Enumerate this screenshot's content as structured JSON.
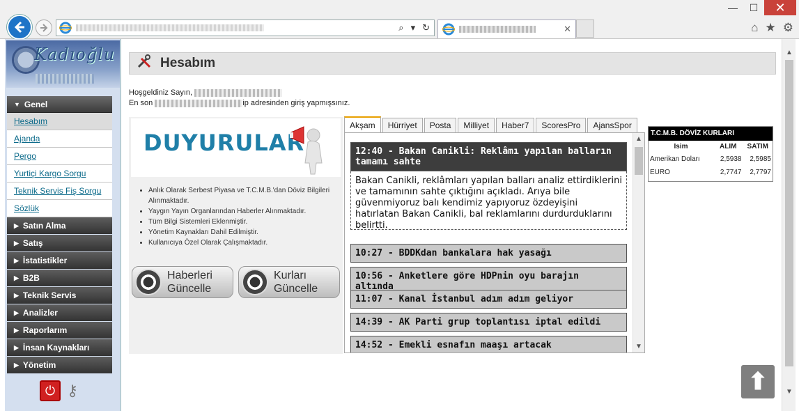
{
  "browser": {
    "back_icon": "back-arrow-icon",
    "forward_icon": "forward-arrow-icon",
    "minimize": "—",
    "maximize": "☐",
    "close": "✕",
    "addr_controls": [
      "⌕",
      "▾",
      "↻"
    ],
    "tab_close": "✕",
    "right_icons": [
      "⌂",
      "★",
      "⚙"
    ]
  },
  "sidebar": {
    "section_header": "Genel",
    "items": [
      {
        "label": "Hesabım",
        "selected": true
      },
      {
        "label": "Ajanda"
      },
      {
        "label": "Pergo"
      },
      {
        "label": "Yurtiçi Kargo Sorgu"
      },
      {
        "label": "Teknik Servis Fiş Sorgu"
      },
      {
        "label": "Sözlük"
      }
    ],
    "sections": [
      {
        "label": "Satın Alma"
      },
      {
        "label": "Satış"
      },
      {
        "label": "İstatistikler"
      },
      {
        "label": "B2B"
      },
      {
        "label": "Teknik Servis"
      },
      {
        "label": "Analizler"
      },
      {
        "label": "Raporlarım"
      },
      {
        "label": "İnsan Kaynakları"
      },
      {
        "label": "Yönetim"
      }
    ],
    "logo_text": "Kadıoğlu"
  },
  "page": {
    "title": "Hesabım",
    "welcome_prefix": "Hoşgeldiniz Sayın,",
    "last_login_prefix": "En son",
    "last_login_suffix": "ip adresinden giriş yapmışsınız."
  },
  "announcements": {
    "title": "DUYURULAR",
    "items": [
      "Anlık Olarak Serbest Piyasa ve T.C.M.B.'dan Döviz Bilgileri Alınmaktadır.",
      "Yaygın Yayın Organlarından Haberler Alınmaktadır.",
      "Tüm Bilgi Sistemleri Eklenmiştir.",
      "Yönetim Kaynakları Dahil Edilmiştir.",
      "Kullanıcıya Özel Olarak Çalışmaktadır."
    ],
    "btn_news_line1": "Haberleri",
    "btn_news_line2": "Güncelle",
    "btn_rates_line1": "Kurları",
    "btn_rates_line2": "Güncelle"
  },
  "news": {
    "tabs": [
      "Akşam",
      "Hürriyet",
      "Posta",
      "Milliyet",
      "Haber7",
      "ScoresPro",
      "AjansSpor"
    ],
    "open_item": {
      "title": "12:40 - Bakan Canikli: Reklâmı yapılan balların tamamı sahte",
      "body": "Bakan Canikli, reklâmları yapılan balları analiz ettirdiklerini ve tamamının sahte çıktığını açıkladı. Arıya bile güvenmiyoruz balı kendimiz yapıyoruz özdeyişini hatırlatan Bakan Canikli, bal reklamlarını durdurduklarını belirtti."
    },
    "items": [
      "10:27 - BDDKdan bankalara hak yasağı",
      "10:56 - Anketlere göre HDPnin oyu barajın altında",
      "11:07 - Kanal İstanbul adım adım geliyor",
      "14:39 - AK Parti grup toplantısı iptal edildi",
      "14:52 - Emekli esnafın maaşı artacak"
    ]
  },
  "currency": {
    "title": "T.C.M.B. DÖVİZ KURLARI",
    "headers": [
      "Isim",
      "ALIM",
      "SATIM"
    ],
    "rows": [
      [
        "Amerikan Doları",
        "2,5938",
        "2,5985"
      ],
      [
        "EURO",
        "2,7747",
        "2,7797"
      ]
    ]
  },
  "scroll": {
    "up": "▲",
    "down": "▼"
  },
  "totop": "⬆"
}
